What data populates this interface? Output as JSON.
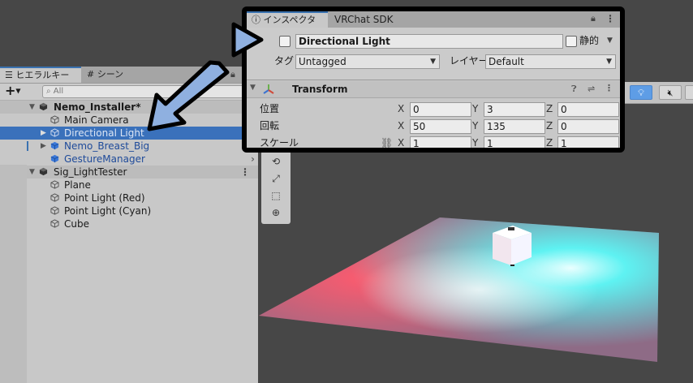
{
  "hierarchy": {
    "tabs": [
      {
        "label": "ヒエラルキー",
        "icon": "list-icon"
      },
      {
        "label": "シーン",
        "icon": "grid-icon"
      }
    ],
    "add_symbol": "+",
    "search_placeholder": "All",
    "rows": [
      {
        "label": "Nemo_Installer*",
        "type": "scene"
      },
      {
        "label": "Main Camera",
        "type": "object"
      },
      {
        "label": "Directional Light",
        "type": "selected"
      },
      {
        "label": "Nemo_Breast_Big",
        "type": "prefab"
      },
      {
        "label": "GestureManager",
        "type": "prefab"
      },
      {
        "label": "Sig_LightTester",
        "type": "scene"
      },
      {
        "label": "Plane",
        "type": "object"
      },
      {
        "label": "Point Light (Red)",
        "type": "object"
      },
      {
        "label": "Point Light (Cyan)",
        "type": "object"
      },
      {
        "label": "Cube",
        "type": "object"
      }
    ]
  },
  "inspector": {
    "tabs": [
      {
        "label": "インスペクター",
        "icon": "info-icon"
      },
      {
        "label": "VRChat SDK"
      }
    ],
    "object_name": "Directional Light",
    "static_label": "静的",
    "tag_label": "タグ",
    "tag_value": "Untagged",
    "layer_label": "レイヤー",
    "layer_value": "Default",
    "component": {
      "name": "Transform",
      "rows": [
        {
          "label": "位置",
          "x": "0",
          "y": "3",
          "z": "0"
        },
        {
          "label": "回転",
          "x": "50",
          "y": "135",
          "z": "0"
        },
        {
          "label": "スケール",
          "x": "1",
          "y": "1",
          "z": "1"
        }
      ],
      "axes": [
        "X",
        "Y",
        "Z"
      ]
    }
  },
  "colors": {
    "selection": "#3a71bb",
    "prefab_text": "#1f4b9a",
    "annotation_arrow": "#8fb0e0",
    "light_red": "#ff5a6e",
    "light_cyan": "#5ef2f2"
  }
}
